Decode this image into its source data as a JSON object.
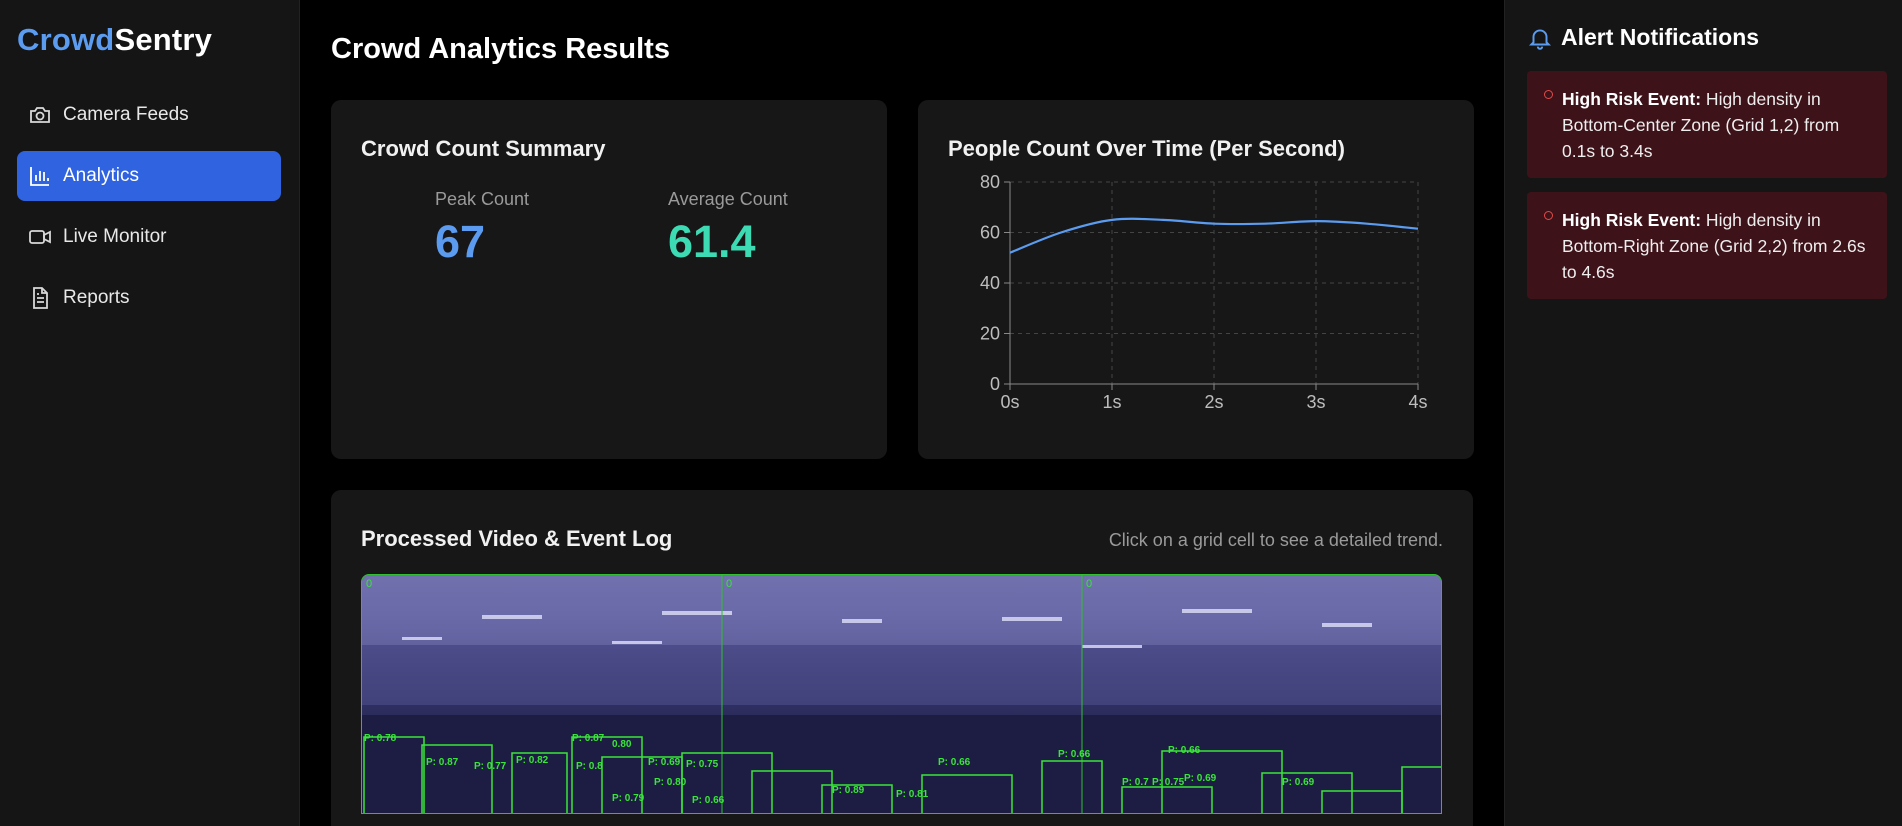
{
  "app": {
    "name_part1": "Crowd",
    "name_part2": "Sentry"
  },
  "sidebar": {
    "items": [
      {
        "label": "Camera Feeds",
        "icon": "camera-icon",
        "active": false
      },
      {
        "label": "Analytics",
        "icon": "bar-chart-icon",
        "active": true
      },
      {
        "label": "Live Monitor",
        "icon": "video-icon",
        "active": false
      },
      {
        "label": "Reports",
        "icon": "document-icon",
        "active": false
      }
    ]
  },
  "main": {
    "title": "Crowd Analytics Results",
    "summary": {
      "title": "Crowd Count Summary",
      "peak_label": "Peak Count",
      "peak_value": "67",
      "avg_label": "Average Count",
      "avg_value": "61.4"
    },
    "chart_card": {
      "title": "People Count Over Time (Per Second)"
    },
    "video_card": {
      "title": "Processed Video & Event Log",
      "hint": "Click on a grid cell to see a detailed trend.",
      "grid_labels": [
        "0",
        "0",
        "0"
      ]
    }
  },
  "chart_data": {
    "type": "line",
    "title": "People Count Over Time (Per Second)",
    "x": [
      0,
      0.5,
      1,
      1.5,
      2,
      2.5,
      3,
      3.5,
      4
    ],
    "x_tick_labels": [
      "0s",
      "1s",
      "2s",
      "3s",
      "4s"
    ],
    "x_ticks": [
      0,
      1,
      2,
      3,
      4
    ],
    "y_ticks": [
      0,
      20,
      40,
      60,
      80
    ],
    "series": [
      {
        "values": [
          52,
          60,
          65,
          65,
          63.5,
          63.5,
          64.5,
          63.5,
          61.5
        ]
      }
    ],
    "xlim": [
      0,
      4
    ],
    "ylim": [
      0,
      80
    ],
    "grid": true,
    "color": "#5b9cf0"
  },
  "alerts": {
    "title": "Alert Notifications",
    "items": [
      {
        "label": "High Risk Event:",
        "text": " High density in Bottom-Center Zone (Grid 1,2) from 0.1s to 3.4s"
      },
      {
        "label": "High Risk Event:",
        "text": " High density in Bottom-Right Zone (Grid 2,2) from 2.6s to 4.6s"
      }
    ]
  },
  "colors": {
    "accent": "#5b9cf0",
    "active_nav": "#2f63e0",
    "avg_value": "#3ddbb4",
    "alert_bg": "#3d1219"
  }
}
